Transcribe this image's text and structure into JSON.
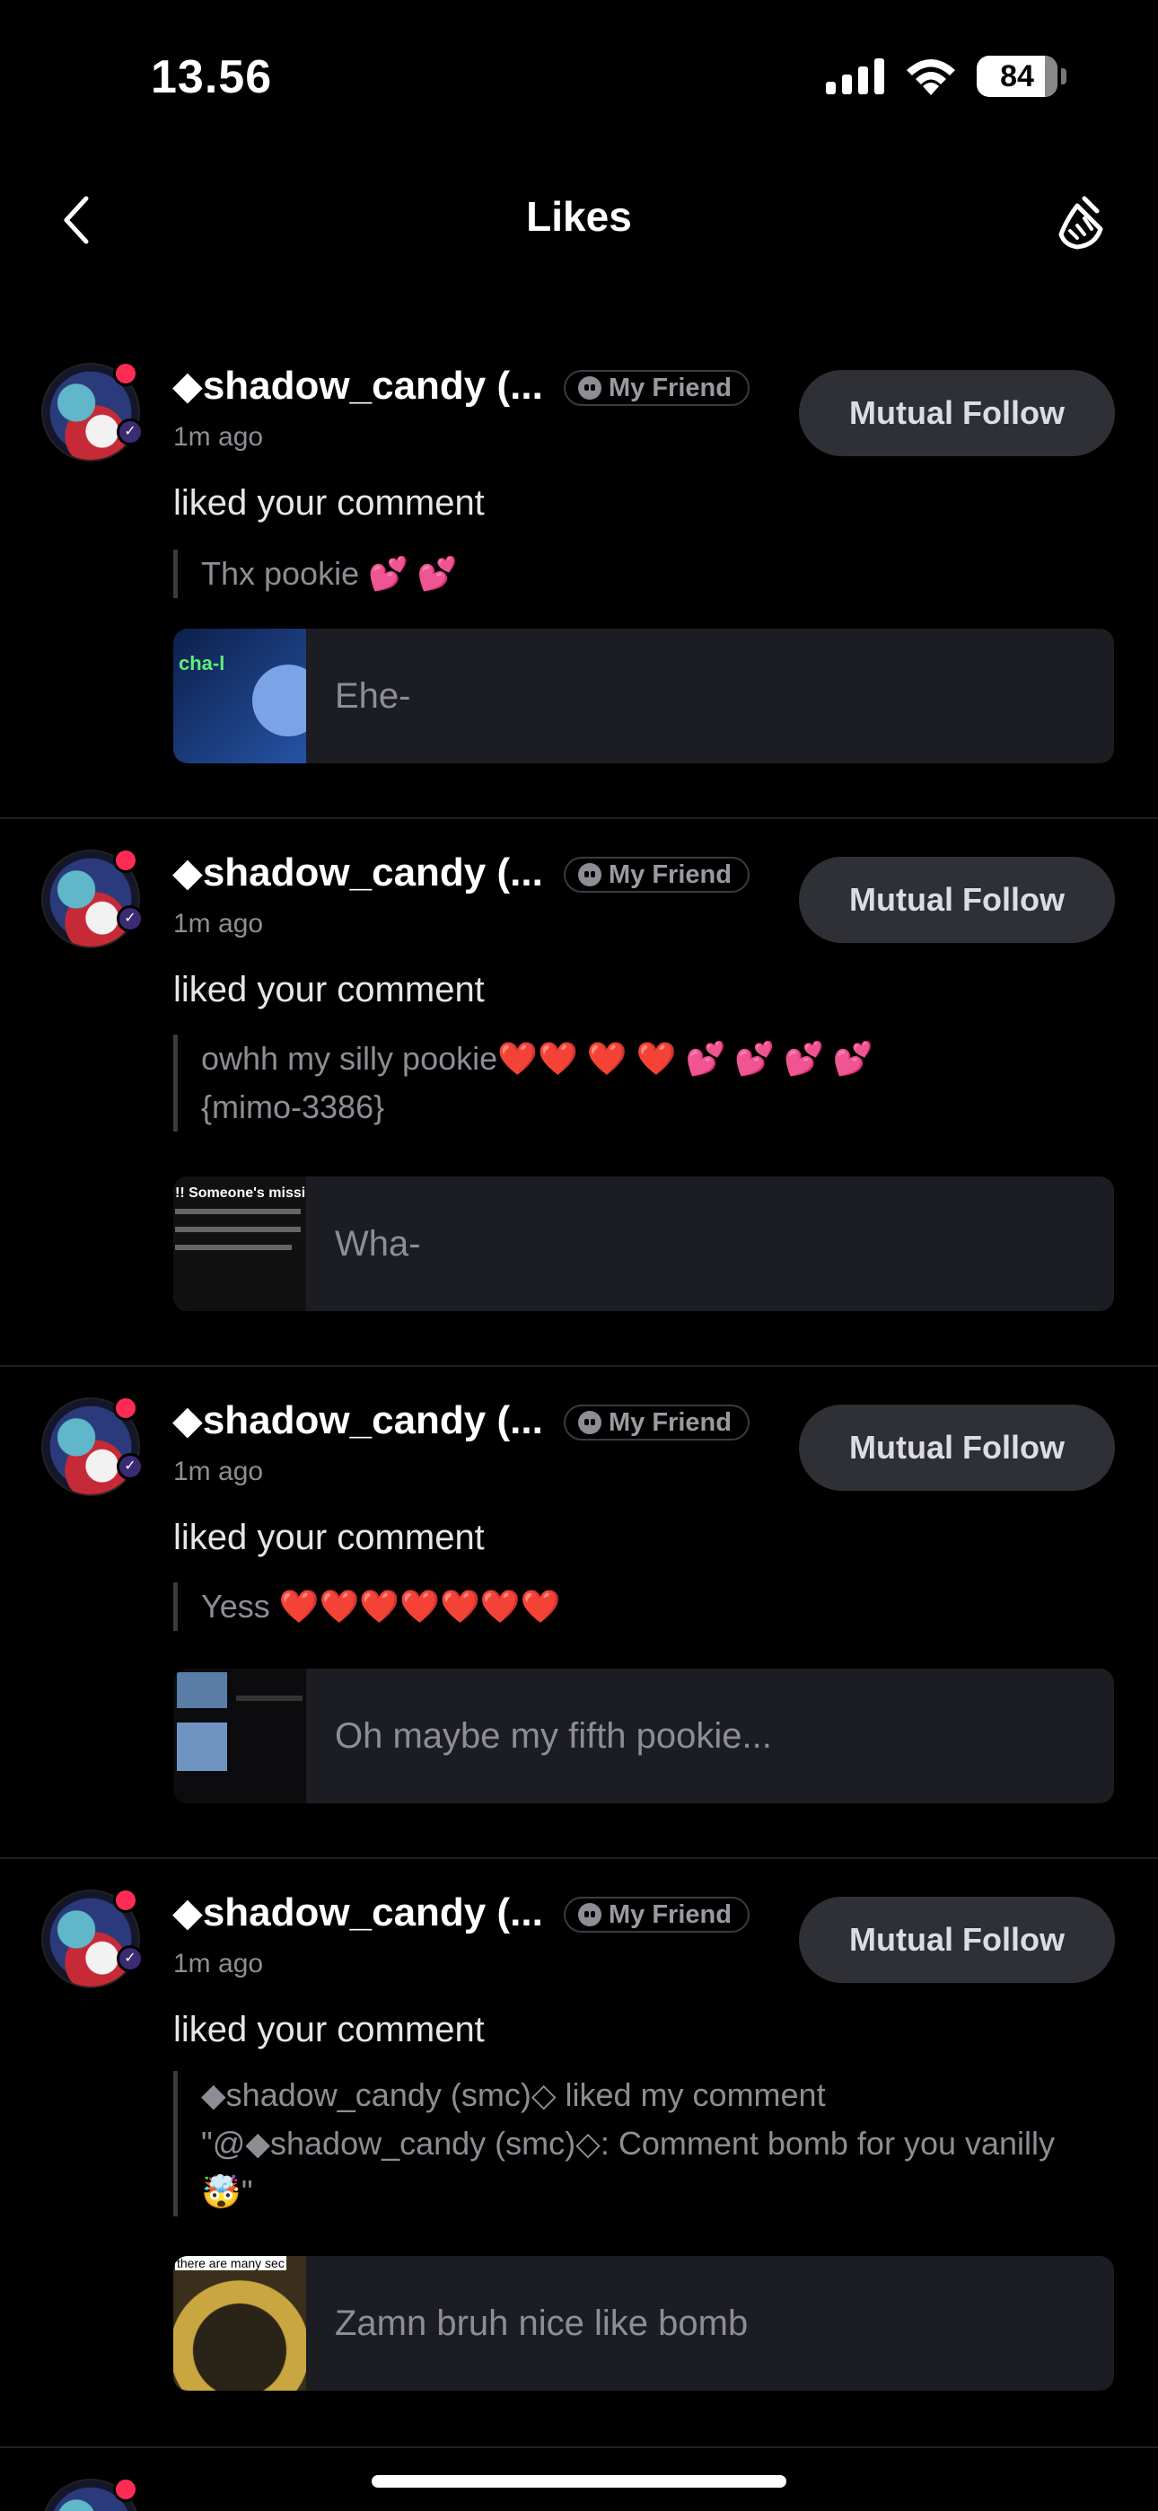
{
  "status": {
    "time": "13.56",
    "battery": "84"
  },
  "nav": {
    "title": "Likes"
  },
  "colors": {
    "background": "#000000",
    "accent_dot": "#fe2c55",
    "button": "#2f3036"
  },
  "items": [
    {
      "username": "◆shadow_candy (...",
      "tag": "My Friend",
      "follow": "Mutual Follow",
      "time": "1m ago",
      "action": "liked your comment",
      "quote": "Thx pookie 💕 💕",
      "post_text": "Ehe-",
      "thumb_text": "cha-l"
    },
    {
      "username": "◆shadow_candy (...",
      "tag": "My Friend",
      "follow": "Mutual Follow",
      "time": "1m ago",
      "action": "liked your comment",
      "quote": "owhh my silly pookie❤️❤️ ❤️ ❤️ 💕 💕 💕 💕 {mimo-3386}",
      "post_text": "Wha-",
      "thumb_text": "!! Someone's missing"
    },
    {
      "username": "◆shadow_candy (...",
      "tag": "My Friend",
      "follow": "Mutual Follow",
      "time": "1m ago",
      "action": "liked your comment",
      "quote": "Yess ❤️❤️❤️❤️❤️❤️❤️",
      "post_text": "Oh maybe my fifth pookie...",
      "thumb_text": ""
    },
    {
      "username": "◆shadow_candy (...",
      "tag": "My Friend",
      "follow": "Mutual Follow",
      "time": "1m ago",
      "action": "liked your comment",
      "quote": "◆shadow_candy (smc)◇ liked my comment \"@◆shadow_candy (smc)◇: Comment bomb for you vanilly🤯\"",
      "post_text": "Zamn bruh nice like bomb",
      "thumb_text": "there are many sec"
    }
  ]
}
